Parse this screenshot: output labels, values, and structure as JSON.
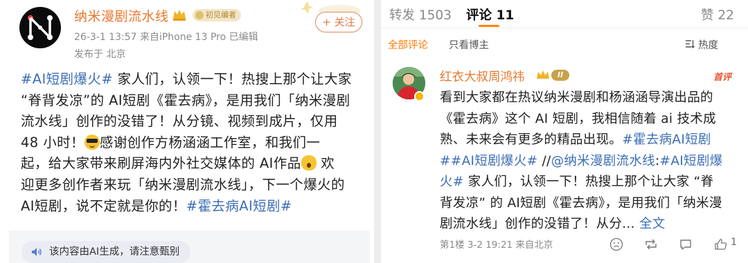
{
  "left_post": {
    "author_name": "纳米漫剧流水线",
    "badge_label": "初见编者",
    "follow_label": "+ 关注",
    "meta_line1": "26-3-1 13:57  来自iPhone 13 Pro  已编辑",
    "meta_line2": "发布于 北京",
    "body_lines": [
      [
        {
          "t": "#AI短剧爆火#",
          "k": "tag"
        },
        {
          "t": " 家人们，认领一下！热搜上那个让大家",
          "k": "text"
        }
      ],
      [
        {
          "t": "“脊背发凉”的 AI短剧《霍去病》，是用我们「纳米漫剧",
          "k": "text"
        }
      ],
      [
        {
          "t": "流水线」创作的没错了！从分镜、视频到成片，仅用",
          "k": "text"
        }
      ],
      [
        {
          "t": "48 小时！",
          "k": "text"
        },
        {
          "t": "cool",
          "k": "emoji"
        },
        {
          "t": "感谢创作方杨涵涵工作室，和我们一",
          "k": "text"
        }
      ],
      [
        {
          "t": "起，给大家带来刷屏海内外社交媒体的 AI作品",
          "k": "text"
        },
        {
          "t": "wow",
          "k": "emoji"
        },
        {
          "t": " 欢",
          "k": "text"
        }
      ],
      [
        {
          "t": "迎更多创作者来玩「纳米漫剧流水线」，下一个爆火的",
          "k": "text"
        }
      ],
      [
        {
          "t": "AI短剧，说不定就是你的！",
          "k": "text"
        },
        {
          "t": "#霍去病AI短剧#",
          "k": "tag"
        }
      ]
    ],
    "ai_notice": "该内容由AI生成，请注意甄别"
  },
  "right_panel": {
    "tabs": [
      {
        "label": "转发 1503"
      },
      {
        "label": "评论 11"
      },
      {
        "label": "赞 22"
      }
    ],
    "filters": [
      {
        "label": "全部评论"
      },
      {
        "label": "只看博主"
      }
    ],
    "sort_label": "热度",
    "comment": {
      "author_name": "红衣大叔周鸿祎",
      "level_badge": "II",
      "first_review_label": "首评",
      "body_lines": [
        [
          {
            "t": "看到大家都在热议纳米漫剧和杨涵涵导演出品的",
            "k": "text"
          }
        ],
        [
          {
            "t": "《霍去病》这个 AI 短剧，我相信随着 ai 技术成",
            "k": "text"
          }
        ],
        [
          {
            "t": "熟、未来会有更多的精品出现。",
            "k": "text"
          },
          {
            "t": "#霍去病AI短剧",
            "k": "tag"
          }
        ],
        [
          {
            "t": "##AI短剧爆火#",
            "k": "tag"
          },
          {
            "t": " //",
            "k": "text"
          },
          {
            "t": "@纳米漫剧流水线",
            "k": "tag"
          },
          {
            "t": ":",
            "k": "text"
          },
          {
            "t": "#AI短剧爆",
            "k": "tag"
          }
        ],
        [
          {
            "t": "火#",
            "k": "tag"
          },
          {
            "t": " 家人们，认领一下！热搜上那个让大家 “脊",
            "k": "text"
          }
        ],
        [
          {
            "t": "背发凉” 的 AI短剧《霍去病》，是用我们「纳米漫",
            "k": "text"
          }
        ],
        [
          {
            "t": "剧流水线」创作的没错了！从分... ",
            "k": "text"
          },
          {
            "t": "全文",
            "k": "full"
          }
        ]
      ],
      "footer": "第1楼  3-2 19:21  来自北京",
      "like_count": "1"
    }
  },
  "colors": {
    "accent_orange": "#ff8200",
    "link_blue": "#3e6fb5",
    "name_orange": "#e8772e"
  }
}
